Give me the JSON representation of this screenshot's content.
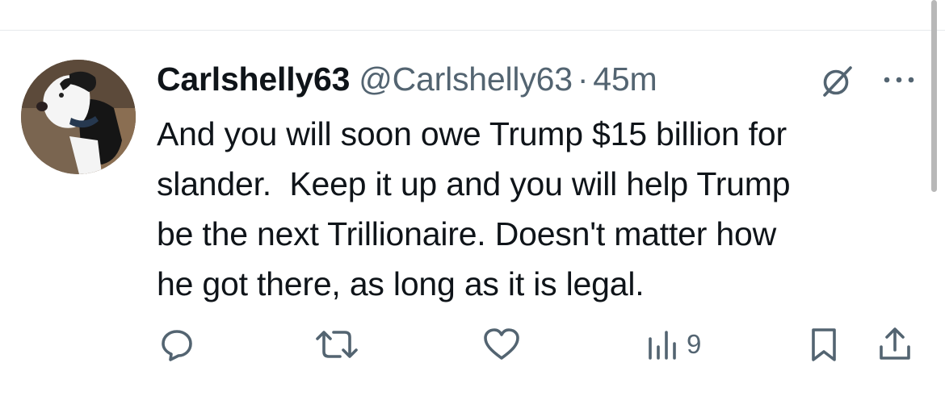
{
  "tweet": {
    "display_name": "Carlshelly63",
    "handle": "@Carlshelly63",
    "separator": "·",
    "time": "45m",
    "text": "And you will soon owe Trump $15 billion for\nslander.  Keep it up and you will help Trump\nbe the next Trillionaire. Doesn't matter how\nhe got there, as long as it is legal."
  },
  "header_icons": [
    "grok-icon",
    "more-icon"
  ],
  "actions": {
    "reply": {
      "icon": "reply-icon"
    },
    "retweet": {
      "icon": "retweet-icon"
    },
    "like": {
      "icon": "heart-icon"
    },
    "views": {
      "icon": "views-icon",
      "count": "9"
    },
    "bookmark": {
      "icon": "bookmark-icon"
    },
    "share": {
      "icon": "share-icon"
    }
  },
  "colors": {
    "text_primary": "#0f1419",
    "text_secondary": "#536471",
    "divider": "#e6e9ec"
  }
}
